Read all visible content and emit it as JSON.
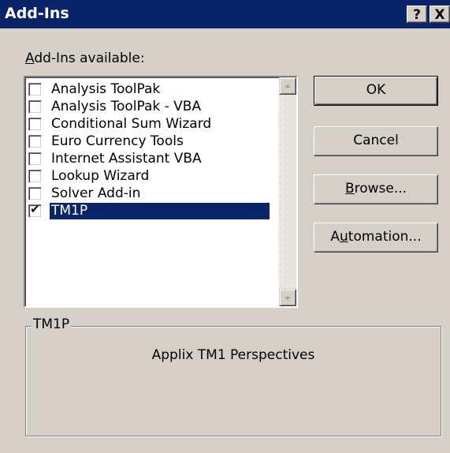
{
  "window": {
    "title": "Add-Ins",
    "help_label": "?",
    "close_label": "X"
  },
  "addins": {
    "label_accel": "A",
    "label_rest": "dd-Ins available:",
    "items": [
      {
        "label": "Analysis ToolPak",
        "checked": false,
        "selected": false
      },
      {
        "label": "Analysis ToolPak - VBA",
        "checked": false,
        "selected": false
      },
      {
        "label": "Conditional Sum Wizard",
        "checked": false,
        "selected": false
      },
      {
        "label": "Euro Currency Tools",
        "checked": false,
        "selected": false
      },
      {
        "label": "Internet Assistant VBA",
        "checked": false,
        "selected": false
      },
      {
        "label": "Lookup Wizard",
        "checked": false,
        "selected": false
      },
      {
        "label": "Solver Add-in",
        "checked": false,
        "selected": false
      },
      {
        "label": "TM1P",
        "checked": true,
        "selected": true
      }
    ]
  },
  "buttons": {
    "ok": "OK",
    "cancel": "Cancel",
    "browse_accel": "B",
    "browse_rest": "rowse...",
    "automation_pre": "A",
    "automation_accel": "u",
    "automation_rest": "tomation..."
  },
  "details": {
    "group_title": "TM1P",
    "description": "Applix TM1 Perspectives"
  },
  "colors": {
    "titlebar": "#0a246a",
    "face": "#d4d0c8",
    "selection": "#0a246a"
  }
}
